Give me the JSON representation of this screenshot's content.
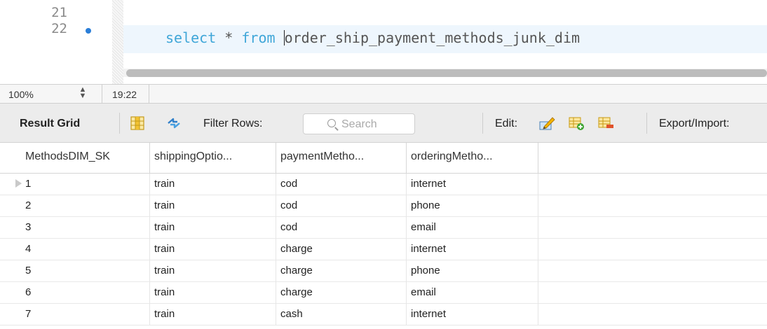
{
  "editor": {
    "line_numbers": [
      "21",
      "22"
    ],
    "query": {
      "kw_select": "select",
      "star": " * ",
      "kw_from": "from",
      "space": " ",
      "table_first": "o",
      "table_rest": "rder_ship_payment_methods_junk_dim"
    }
  },
  "statusbar": {
    "zoom": "100%",
    "cursor_position": "19:22"
  },
  "toolbar": {
    "result_grid_label": "Result Grid",
    "filter_rows_label": "Filter Rows:",
    "search_placeholder": "Search",
    "edit_label": "Edit:",
    "export_import_label": "Export/Import:"
  },
  "grid": {
    "columns": [
      "MethodsDIM_SK",
      "shippingOptio...",
      "paymentMetho...",
      "orderingMetho..."
    ],
    "rows": [
      [
        "1",
        "train",
        "cod",
        "internet"
      ],
      [
        "2",
        "train",
        "cod",
        "phone"
      ],
      [
        "3",
        "train",
        "cod",
        "email"
      ],
      [
        "4",
        "train",
        "charge",
        "internet"
      ],
      [
        "5",
        "train",
        "charge",
        "phone"
      ],
      [
        "6",
        "train",
        "charge",
        "email"
      ],
      [
        "7",
        "train",
        "cash",
        "internet"
      ]
    ]
  },
  "icons": {
    "breakpoint": "breakpoint-dot-icon",
    "grid_toggle": "result-grid-columns-icon",
    "refresh": "refresh-arrows-icon",
    "edit_cell": "edit-pencil-icon",
    "add_row": "add-row-icon",
    "delete_row": "delete-row-icon"
  },
  "colors": {
    "keyword": "#3fa6d8",
    "active_line": "#eef6fd",
    "breakpoint": "#2a7ed8"
  }
}
